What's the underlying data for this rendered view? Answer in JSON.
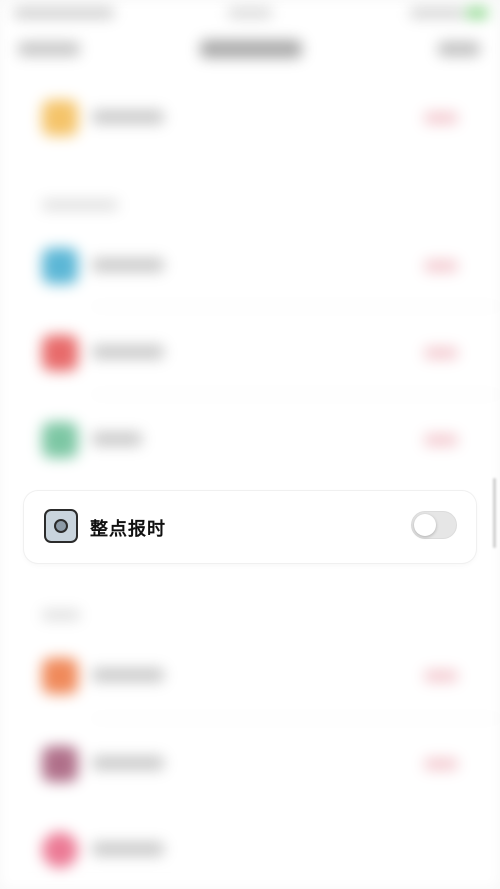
{
  "card": {
    "label": "整点报时",
    "icon": "watch-face-icon",
    "toggle_on": false
  },
  "colors": {
    "toggle_off_track": "#e6e6e6",
    "icon_fill": "#c9d4dd",
    "card_background": "#ffffff",
    "background_tag": "#f3c9cf"
  },
  "background": {
    "blurred": true,
    "icon_colors": [
      "#f5c46a",
      "#5cb7d6",
      "#e86b6b",
      "#7dc7a4",
      "#f08a5b",
      "#b0708a",
      "#ec7a95"
    ]
  }
}
